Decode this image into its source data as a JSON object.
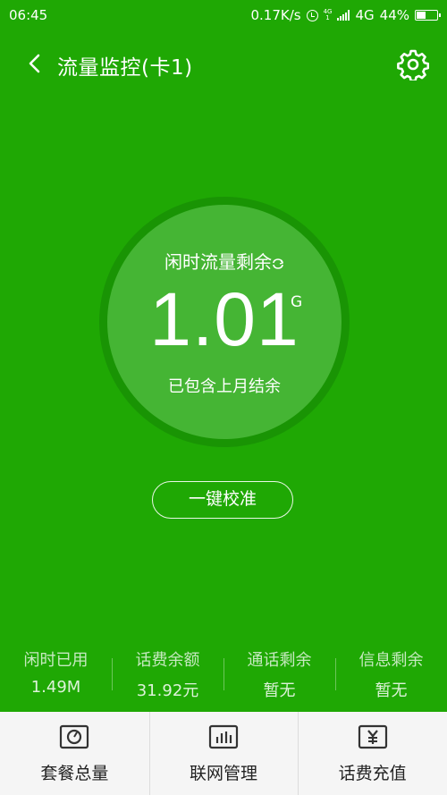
{
  "status_bar": {
    "time": "06:45",
    "speed": "0.17K/s",
    "network": "4G",
    "sim_label_top": "4G",
    "sim_label_bottom": "1",
    "battery": "44%",
    "battery_level": 0.44
  },
  "header": {
    "title": "流量监控(卡1)"
  },
  "usage": {
    "caption": "闲时流量剩余",
    "value": "1.01",
    "unit": "G",
    "note": "已包含上月结余"
  },
  "calibrate_label": "一键校准",
  "stats": [
    {
      "label": "闲时已用",
      "value": "1.49M"
    },
    {
      "label": "话费余额",
      "value": "31.92元"
    },
    {
      "label": "通话剩余",
      "value": "暂无"
    },
    {
      "label": "信息剩余",
      "value": "暂无"
    }
  ],
  "nav": [
    {
      "label": "套餐总量",
      "icon": "gauge-icon"
    },
    {
      "label": "联网管理",
      "icon": "bar-chart-icon"
    },
    {
      "label": "话费充值",
      "icon": "yuan-icon"
    }
  ],
  "colors": {
    "background": "#1fa804",
    "circle": "#45b534",
    "nav_background": "#f5f5f5"
  }
}
